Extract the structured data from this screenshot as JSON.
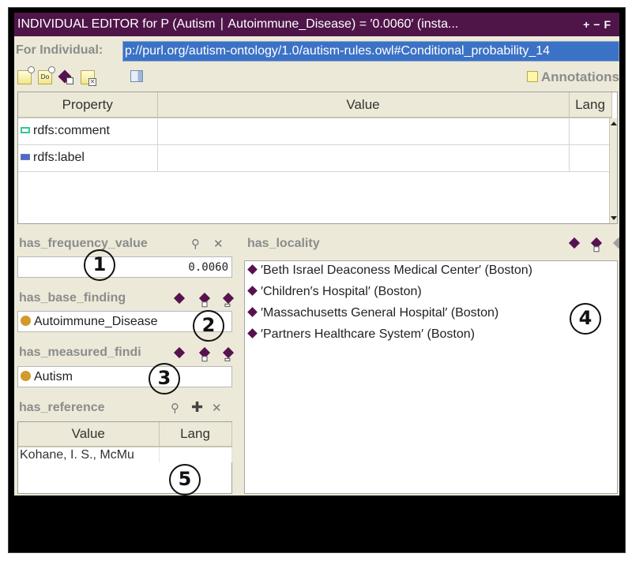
{
  "window": {
    "title": "INDIVIDUAL EDITOR for P (Autism ∣ Autoimmune_Disease)  =  ′0.0060′  (insta...",
    "controls": [
      "+",
      "−",
      "F"
    ]
  },
  "individual": {
    "label": "For Individual:",
    "value": "p://purl.org/autism-ontology/1.0/autism-rules.owl#Conditional_probability_14"
  },
  "toolbar": {
    "icons": [
      "create-annotation-icon",
      "create-annotation-from-template-icon",
      "add-property-value-icon",
      "delete-annotation-icon",
      "view-columns-icon"
    ],
    "annotations_label": "Annotations"
  },
  "annotations_table": {
    "columns": [
      "Property",
      "Value",
      "Lang"
    ],
    "rows": [
      {
        "property": "rdfs:comment",
        "value": "",
        "lang": "",
        "icon_color": "#3cc39a"
      },
      {
        "property": "rdfs:label",
        "value": "",
        "lang": "",
        "icon_color": "#4a6ad2"
      }
    ]
  },
  "slots": {
    "frequency": {
      "title": "has_frequency_value",
      "value": "0.0060"
    },
    "base_finding": {
      "title": "has_base_finding",
      "value": "Autoimmune_Disease"
    },
    "measured_finding": {
      "title": "has_measured_findi",
      "value": "Autism"
    },
    "reference": {
      "title": "has_reference",
      "columns": [
        "Value",
        "Lang"
      ],
      "rows": [
        {
          "value": "Kohane, I. S., McMu",
          "lang": ""
        }
      ]
    },
    "locality": {
      "title": "has_locality",
      "items": [
        "′Beth Israel Deaconess Medical Center′  (Boston)",
        "′Children′s Hospital′  (Boston)",
        "′Massachusetts General Hospital′  (Boston)",
        "′Partners Healthcare System′  (Boston)"
      ]
    }
  },
  "callouts": [
    "1",
    "2",
    "3",
    "4",
    "5"
  ],
  "colors": {
    "titlebar": "#4f1549",
    "selection": "#3b72c6",
    "panel": "#ece9d8",
    "instance_diamond": "#57124f",
    "class_dot": "#d49a2a"
  }
}
